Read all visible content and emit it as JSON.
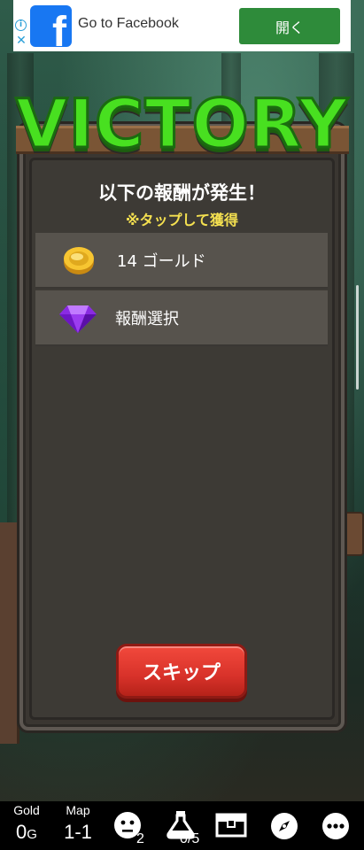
{
  "ad": {
    "text": "Go to Facebook",
    "button": "開く",
    "brand_color": "#1877f2"
  },
  "dialog": {
    "heading": "VICTORY",
    "title": "以下の報酬が発生！",
    "subtitle": "※タップして獲得",
    "rewards": [
      {
        "icon": "gold-coin-icon",
        "label": "14 ゴールド"
      },
      {
        "icon": "purple-gem-icon",
        "label": "報酬選択"
      }
    ],
    "skip_button": "スキップ"
  },
  "status_bar": {
    "gold_label": "Gold",
    "gold_value": "0",
    "gold_unit": "G",
    "map_label": "Map",
    "map_value": "1-1",
    "party_count": "2",
    "potion_count": "0/5",
    "icons": [
      "face-icon",
      "potion-icon",
      "treasure-chest-icon",
      "compass-icon",
      "more-icon"
    ]
  },
  "colors": {
    "victory_green": "#48e020",
    "subtitle_yellow": "#f4e050",
    "skip_red": "#e03a2f",
    "ad_button_green": "#2e8b3a"
  }
}
